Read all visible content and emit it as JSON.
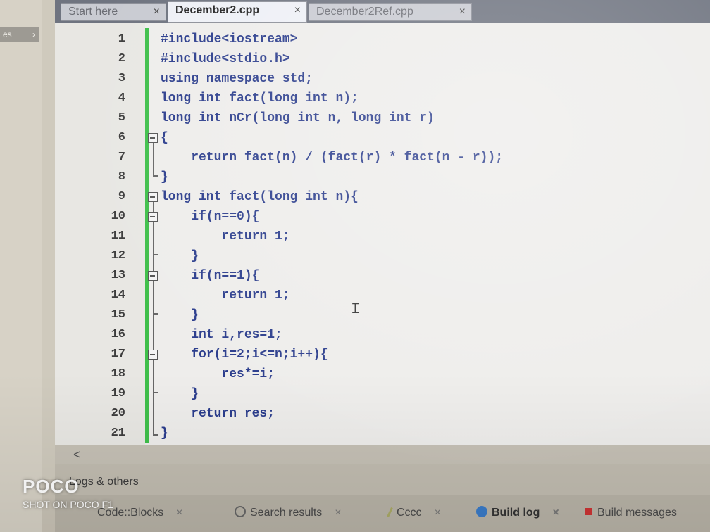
{
  "left_panel": {
    "tab_label": "es",
    "arrow": "›"
  },
  "tabs": [
    {
      "label": "Start here",
      "close": "×"
    },
    {
      "label": "December2.cpp",
      "close": "×"
    },
    {
      "label": "December2Ref.cpp",
      "close": "×"
    }
  ],
  "editor": {
    "line_numbers": [
      "1",
      "2",
      "3",
      "4",
      "5",
      "6",
      "7",
      "8",
      "9",
      "10",
      "11",
      "12",
      "13",
      "14",
      "15",
      "16",
      "17",
      "18",
      "19",
      "20",
      "21"
    ],
    "lines": [
      "#include<iostream>",
      "#include<stdio.h>",
      "using namespace std;",
      "long int fact(long int n);",
      "long int nCr(long int n, long int r)",
      "{",
      "    return fact(n) / (fact(r) * fact(n - r));",
      "}",
      "long int fact(long int n){",
      "    if(n==0){",
      "        return 1;",
      "    }",
      "    if(n==1){",
      "        return 1;",
      "    }",
      "    int i,res=1;",
      "    for(i=2;i<=n;i++){",
      "        res*=i;",
      "    }",
      "    return res;",
      "}"
    ],
    "cursor_glyph": "I",
    "scroll_left": "<"
  },
  "bottom_panel": {
    "title": "Logs & others",
    "tabs": [
      {
        "label": "Code::Blocks",
        "close": "×"
      },
      {
        "label": "Search results",
        "close": "×"
      },
      {
        "label": "Cccc",
        "close": "×"
      },
      {
        "label": "Build log",
        "close": "×"
      },
      {
        "label": "Build messages",
        "close": ""
      }
    ]
  },
  "watermark": {
    "brand": "POCO",
    "sub": "SHOT ON POCO F1"
  },
  "colors": {
    "keyword": "#2a3c8c",
    "accent_green": "#3fbf4a",
    "tabbar": "#6f7480"
  }
}
